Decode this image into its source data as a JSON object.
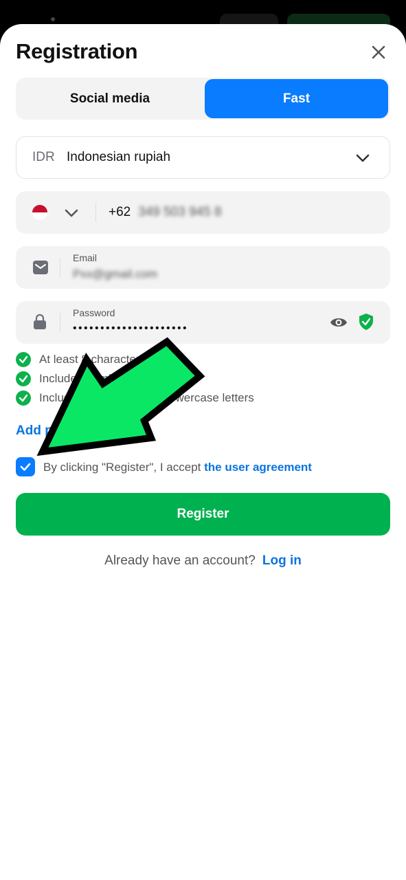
{
  "header": {
    "title": "Registration"
  },
  "tabs": [
    {
      "label": "Social media",
      "active": false
    },
    {
      "label": "Fast",
      "active": true
    }
  ],
  "currency": {
    "code": "IDR",
    "name": "Indonesian rupiah"
  },
  "phone": {
    "country_flag": "indonesia-flag-icon",
    "code": "+62",
    "number": "349 503 945 8"
  },
  "email": {
    "label": "Email",
    "value": "Pxx@gmail.com"
  },
  "password": {
    "label": "Password",
    "value": "•••••••••••••••••••••"
  },
  "requirements": [
    {
      "text": "At least 8 characters"
    },
    {
      "text": "Includes numbers"
    },
    {
      "text": "Includes uppercase and lowercase letters"
    }
  ],
  "add_link": {
    "label": "Add promo code"
  },
  "agreement": {
    "checked": true,
    "text": "By clicking \"Register\", I accept ",
    "link": "the user agreement"
  },
  "register_button": {
    "label": "Register"
  },
  "login": {
    "question": "Already have an account?",
    "link": "Log in"
  },
  "colors": {
    "accent_blue": "#0a7cff",
    "register_green": "#00b14f",
    "link_blue": "#0a74e0",
    "arrow_green": "#09e765"
  }
}
